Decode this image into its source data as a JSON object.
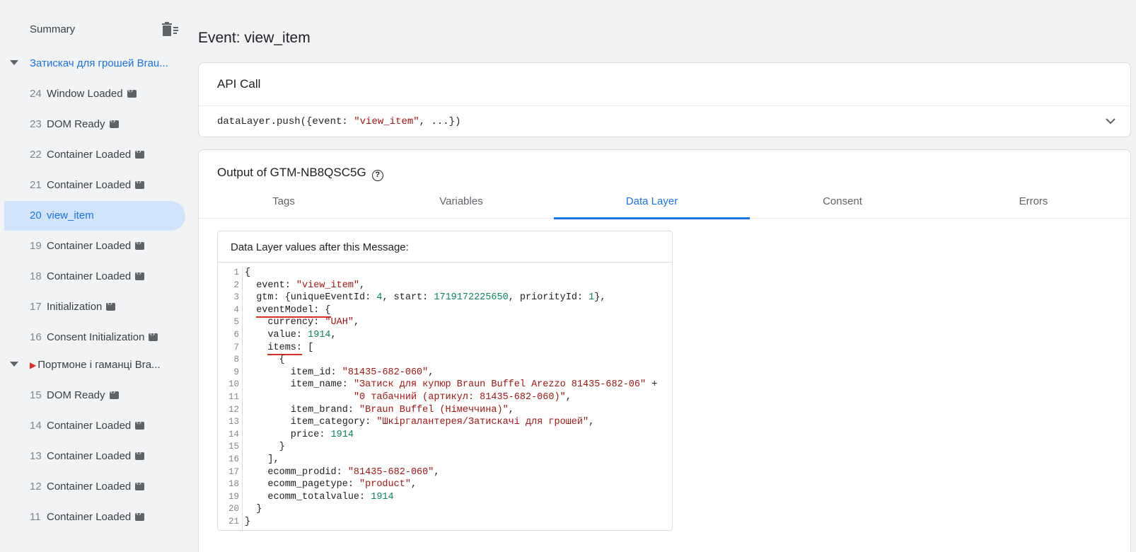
{
  "sidebar": {
    "summary_label": "Summary",
    "groups": [
      {
        "label": "Затискач для грошей Brau...",
        "events": [
          {
            "num": "24",
            "name": "Window Loaded"
          },
          {
            "num": "23",
            "name": "DOM Ready"
          },
          {
            "num": "22",
            "name": "Container Loaded"
          },
          {
            "num": "21",
            "name": "Container Loaded"
          },
          {
            "num": "20",
            "name": "view_item"
          },
          {
            "num": "19",
            "name": "Container Loaded"
          },
          {
            "num": "18",
            "name": "Container Loaded"
          },
          {
            "num": "17",
            "name": "Initialization"
          },
          {
            "num": "16",
            "name": "Consent Initialization"
          }
        ]
      },
      {
        "label": "Портмоне і гаманці Bra...",
        "events": [
          {
            "num": "15",
            "name": "DOM Ready"
          },
          {
            "num": "14",
            "name": "Container Loaded"
          },
          {
            "num": "13",
            "name": "Container Loaded"
          },
          {
            "num": "12",
            "name": "Container Loaded"
          },
          {
            "num": "11",
            "name": "Container Loaded"
          }
        ]
      }
    ]
  },
  "main": {
    "title": "Event: view_item",
    "api_call": {
      "title": "API Call",
      "code_prefix": "dataLayer.push({event: ",
      "code_string": "\"view_item\"",
      "code_suffix": ", ...})"
    },
    "output": {
      "title": "Output of GTM-NB8QSC5G",
      "tabs": [
        "Tags",
        "Variables",
        "Data Layer",
        "Consent",
        "Errors"
      ],
      "active_tab": "Data Layer",
      "data_layer_header": "Data Layer values after this Message:",
      "code": [
        [
          {
            "t": "{"
          }
        ],
        [
          {
            "t": "  event: "
          },
          {
            "t": "\"view_item\"",
            "c": "str"
          },
          {
            "t": ","
          }
        ],
        [
          {
            "t": "  gtm: {uniqueEventId: "
          },
          {
            "t": "4",
            "c": "num"
          },
          {
            "t": ", start: "
          },
          {
            "t": "1719172225650",
            "c": "num"
          },
          {
            "t": ", priorityId: "
          },
          {
            "t": "1",
            "c": "num"
          },
          {
            "t": "},"
          }
        ],
        [
          {
            "t": "  "
          },
          {
            "t": "eventModel: {",
            "c": "ul"
          }
        ],
        [
          {
            "t": "    currency: "
          },
          {
            "t": "\"UAH\"",
            "c": "str"
          },
          {
            "t": ","
          }
        ],
        [
          {
            "t": "    value: "
          },
          {
            "t": "1914",
            "c": "num"
          },
          {
            "t": ","
          }
        ],
        [
          {
            "t": "    "
          },
          {
            "t": "items:",
            "c": "ul"
          },
          {
            "t": " ["
          }
        ],
        [
          {
            "t": "      {"
          }
        ],
        [
          {
            "t": "        item_id: "
          },
          {
            "t": "\"81435-682-060\"",
            "c": "str"
          },
          {
            "t": ","
          }
        ],
        [
          {
            "t": "        item_name: "
          },
          {
            "t": "\"Затиск для купюр Braun Buffel Arezzo 81435-682-06\"",
            "c": "str"
          },
          {
            "t": " +"
          }
        ],
        [
          {
            "t": "                   "
          },
          {
            "t": "\"0 табачний (артикул: 81435-682-060)\"",
            "c": "str"
          },
          {
            "t": ","
          }
        ],
        [
          {
            "t": "        item_brand: "
          },
          {
            "t": "\"Braun Buffel (Німеччина)\"",
            "c": "str"
          },
          {
            "t": ","
          }
        ],
        [
          {
            "t": "        item_category: "
          },
          {
            "t": "\"Шкіргалантерея/Затискачі для грошей\"",
            "c": "str"
          },
          {
            "t": ","
          }
        ],
        [
          {
            "t": "        price: "
          },
          {
            "t": "1914",
            "c": "num"
          }
        ],
        [
          {
            "t": "      }"
          }
        ],
        [
          {
            "t": "    ],"
          }
        ],
        [
          {
            "t": "    ecomm_prodid: "
          },
          {
            "t": "\"81435-682-060\"",
            "c": "str"
          },
          {
            "t": ","
          }
        ],
        [
          {
            "t": "    ecomm_pagetype: "
          },
          {
            "t": "\"product\"",
            "c": "str"
          },
          {
            "t": ","
          }
        ],
        [
          {
            "t": "    ecomm_totalvalue: "
          },
          {
            "t": "1914",
            "c": "num"
          }
        ],
        [
          {
            "t": "  }"
          }
        ],
        [
          {
            "t": "}"
          }
        ]
      ]
    }
  },
  "colors": {
    "accent": "#1a73e8",
    "active_row_bg": "#d2e3fc",
    "string": "#a31515",
    "number": "#098658",
    "annotation_underline": "#d93025"
  }
}
